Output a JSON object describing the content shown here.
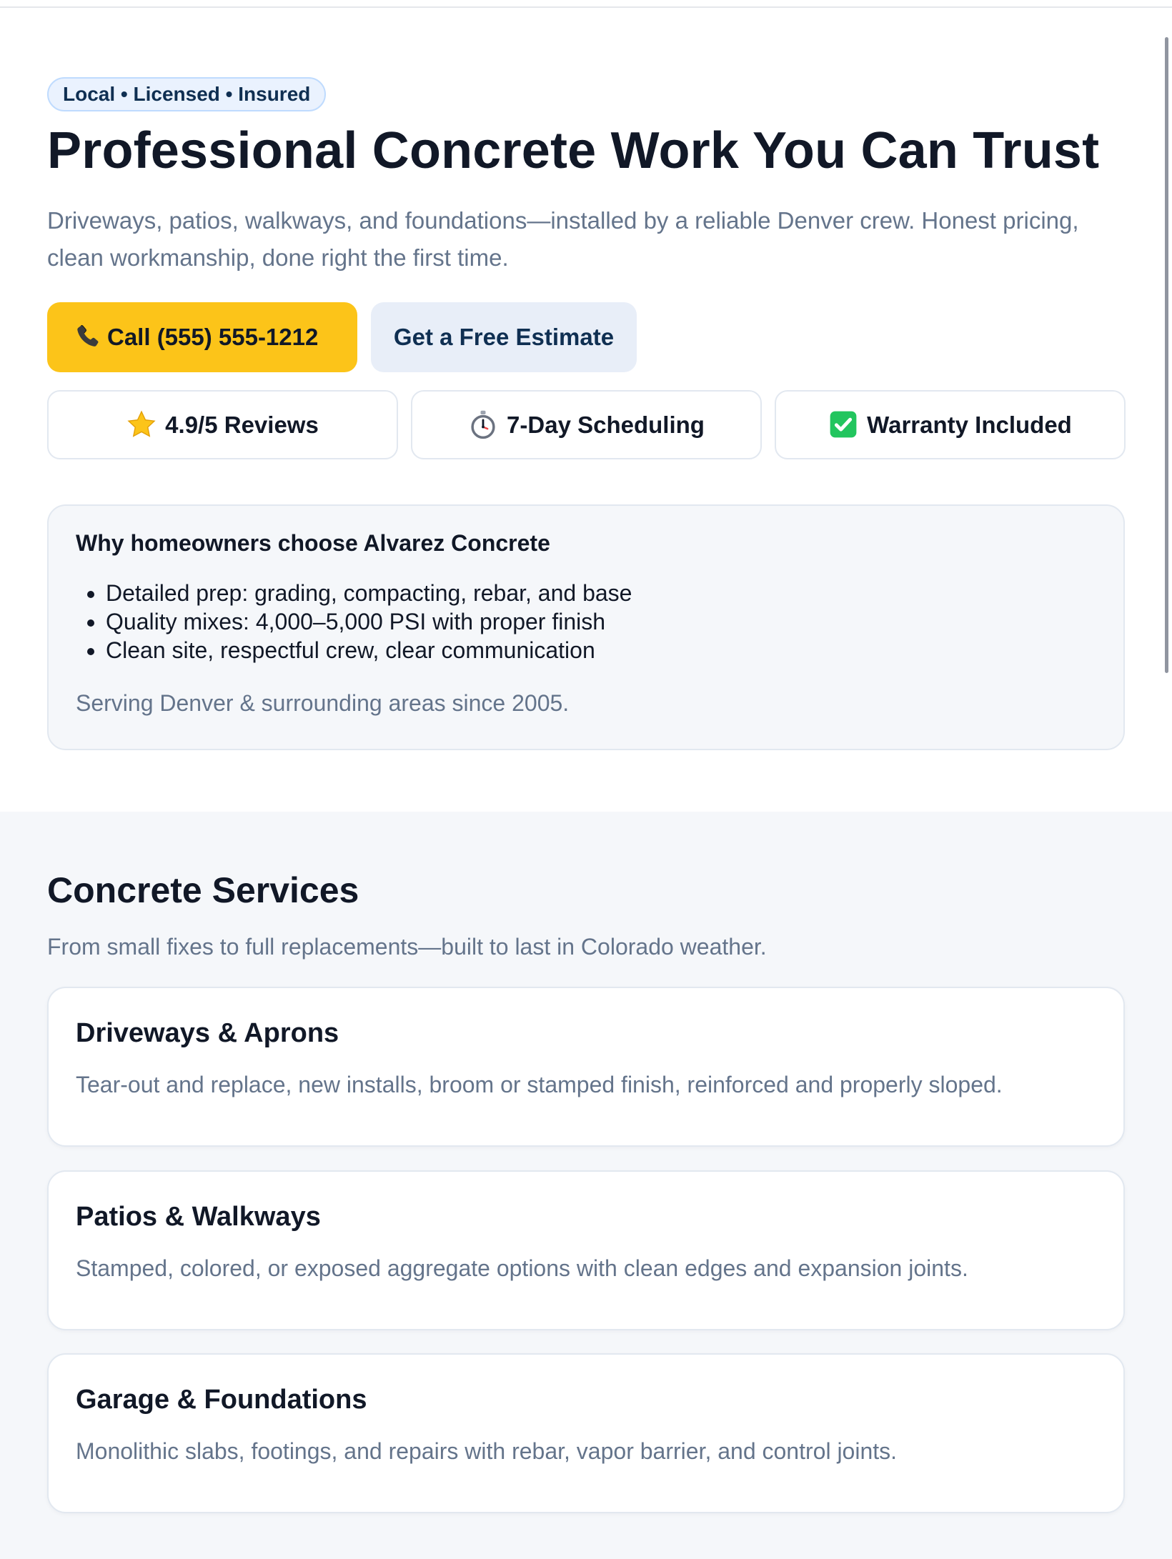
{
  "hero": {
    "badge": "Local • Licensed • Insured",
    "title": "Professional Concrete Work You Can Trust",
    "subtitle": "Driveways, patios, walkways, and foundations—installed by a reliable Denver crew. Honest pricing, clean workmanship, done right the first time.",
    "call_label": "Call (555) 555-1212",
    "call_icon": "phone-icon",
    "estimate_label": "Get a Free Estimate",
    "trust": [
      {
        "icon": "star-icon",
        "label": "4.9/5 Reviews"
      },
      {
        "icon": "stopwatch-icon",
        "label": "7-Day Scheduling"
      },
      {
        "icon": "checkmark-icon",
        "label": "Warranty Included"
      }
    ]
  },
  "why": {
    "title": "Why homeowners choose Alvarez Concrete",
    "points": [
      "Detailed prep: grading, compacting, rebar, and base",
      "Quality mixes: 4,000–5,000 PSI with proper finish",
      "Clean site, respectful crew, clear communication"
    ],
    "footnote": "Serving Denver & surrounding areas since 2005."
  },
  "services": {
    "title": "Concrete Services",
    "subtitle": "From small fixes to full replacements—built to last in Colorado weather.",
    "cards": [
      {
        "title": "Driveways & Aprons",
        "description": "Tear-out and replace, new installs, broom or stamped finish, reinforced and properly sloped."
      },
      {
        "title": "Patios & Walkways",
        "description": "Stamped, colored, or exposed aggregate options with clean edges and expansion joints."
      },
      {
        "title": "Garage & Foundations",
        "description": "Monolithic slabs, footings, and repairs with rebar, vapor barrier, and control joints."
      }
    ]
  },
  "colors": {
    "accent": "#fcc419",
    "brand_navy": "#0f2f52",
    "badge_bg": "#eaf2fe",
    "muted_text": "#64748b",
    "section_bg": "#f5f7fa",
    "check_green": "#22c55e"
  }
}
